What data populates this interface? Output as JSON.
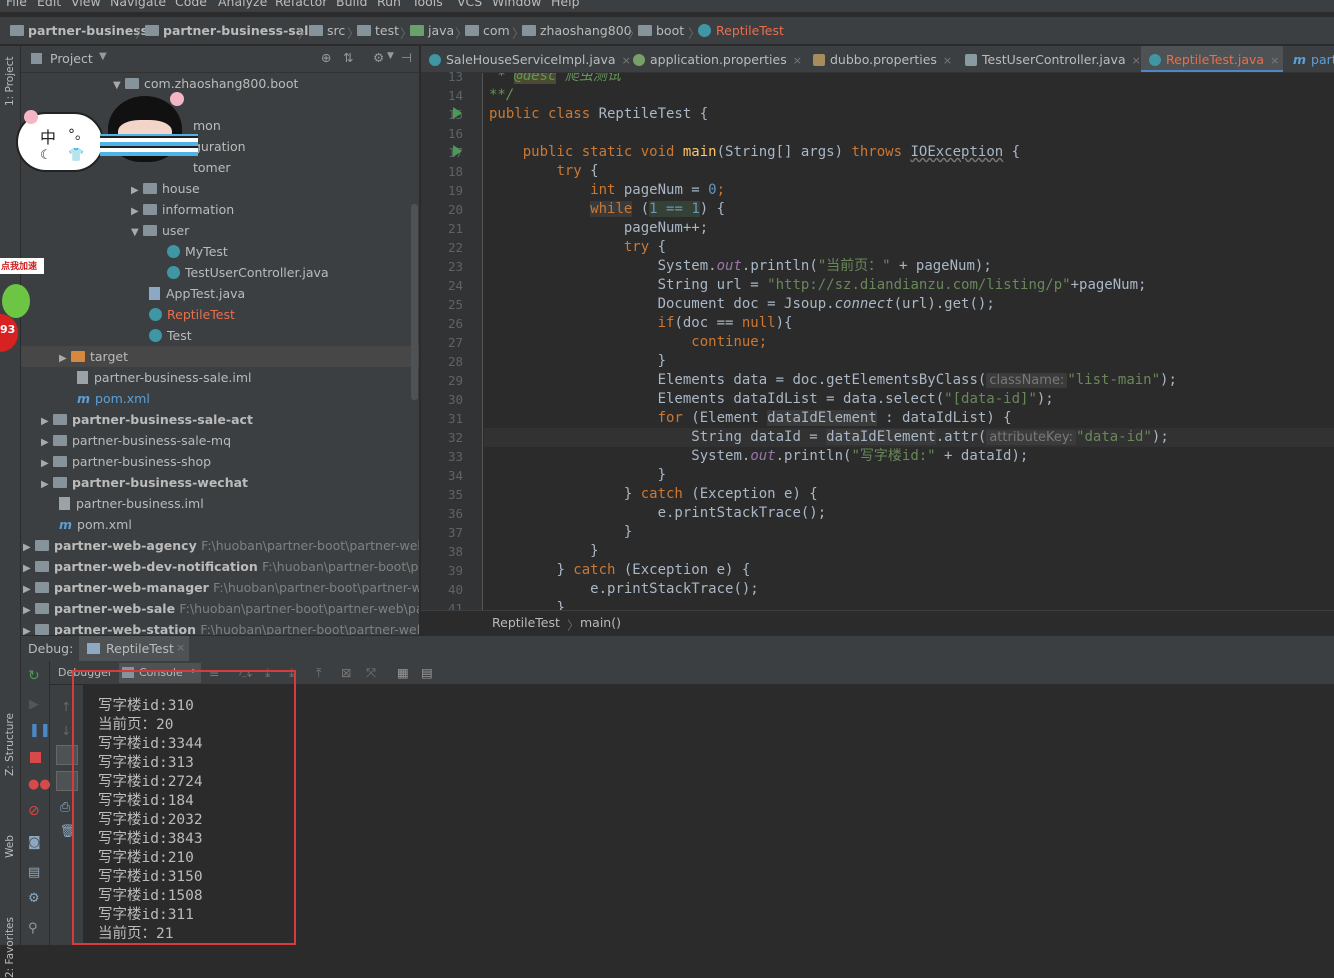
{
  "menu": [
    "File",
    "Edit",
    "View",
    "Navigate",
    "Code",
    "Analyze",
    "Refactor",
    "Build",
    "Run",
    "Tools",
    "VCS",
    "Window",
    "Help"
  ],
  "breadcrumbs": [
    "partner-business",
    "partner-business-sale",
    "src",
    "test",
    "java",
    "com",
    "zhaoshang800",
    "boot",
    "ReptileTest"
  ],
  "left_strip": {
    "project": "1: Project",
    "structure": "Z: Structure",
    "web": "Web",
    "favorites": "2: Favorites"
  },
  "project_panel": {
    "title": "Project"
  },
  "tree": [
    {
      "label": "com.zhaoshang800.boot",
      "kind": "pkg",
      "arrow": "▼"
    },
    {
      "label": "mon",
      "kind": "pkg",
      "arrow": ""
    },
    {
      "label": "guration",
      "kind": "pkg",
      "arrow": ""
    },
    {
      "label": "tomer",
      "kind": "pkg",
      "arrow": ""
    },
    {
      "label": "house",
      "kind": "pkg",
      "arrow": "▶"
    },
    {
      "label": "information",
      "kind": "pkg",
      "arrow": "▶"
    },
    {
      "label": "user",
      "kind": "pkg",
      "arrow": "▼"
    },
    {
      "label": "MyTest",
      "kind": "class",
      "arrow": ""
    },
    {
      "label": "TestUserController.java",
      "kind": "class",
      "arrow": ""
    },
    {
      "label": "AppTest.java",
      "kind": "file",
      "arrow": ""
    },
    {
      "label": "ReptileTest",
      "kind": "class-red",
      "arrow": ""
    },
    {
      "label": "Test",
      "kind": "class",
      "arrow": ""
    },
    {
      "label": "target",
      "kind": "orange",
      "arrow": "▶"
    },
    {
      "label": "partner-business-sale.iml",
      "kind": "file",
      "arrow": ""
    },
    {
      "label": "pom.xml",
      "kind": "mvn-blue",
      "arrow": ""
    },
    {
      "label": "partner-business-sale-act",
      "kind": "mod-bold",
      "arrow": "▶"
    },
    {
      "label": "partner-business-sale-mq",
      "kind": "mod",
      "arrow": "▶"
    },
    {
      "label": "partner-business-shop",
      "kind": "mod",
      "arrow": "▶"
    },
    {
      "label": "partner-business-wechat",
      "kind": "mod-bold",
      "arrow": "▶"
    },
    {
      "label": "partner-business.iml",
      "kind": "file",
      "arrow": ""
    },
    {
      "label": "pom.xml",
      "kind": "mvn",
      "arrow": ""
    },
    {
      "label": "partner-web-agency",
      "kind": "mod-bold",
      "arrow": "▶",
      "path": "F:\\huoban\\partner-boot\\partner-web\\pa"
    },
    {
      "label": "partner-web-dev-notification",
      "kind": "mod-bold",
      "arrow": "▶",
      "path": "F:\\huoban\\partner-boot\\partn"
    },
    {
      "label": "partner-web-manager",
      "kind": "mod-bold",
      "arrow": "▶",
      "path": "F:\\huoban\\partner-boot\\partner-web\\"
    },
    {
      "label": "partner-web-sale",
      "kind": "mod-bold",
      "arrow": "▶",
      "path": "F:\\huoban\\partner-boot\\partner-web\\partr"
    },
    {
      "label": "partner-web-station",
      "kind": "mod-bold",
      "arrow": "▶",
      "path": "F:\\huoban\\partner-boot\\partner-web\\pa"
    }
  ],
  "widgets": {
    "ime_char": "中",
    "ime_punct": "°。",
    "badge_text": "点我加速",
    "badge_num": "93"
  },
  "tabs": [
    {
      "label": "SaleHouseServiceImpl.java"
    },
    {
      "label": "application.properties"
    },
    {
      "label": "dubbo.properties"
    },
    {
      "label": "TestUserController.java"
    },
    {
      "label": "ReptileTest.java"
    },
    {
      "label": "part"
    }
  ],
  "line_numbers": [
    "13",
    "14",
    "15",
    "16",
    "17",
    "18",
    "19",
    "20",
    "21",
    "22",
    "23",
    "24",
    "25",
    "26",
    "27",
    "28",
    "29",
    "30",
    "31",
    "32",
    "33",
    "34",
    "35",
    "36",
    "37",
    "38",
    "39",
    "40",
    "41"
  ],
  "code": {
    "l13_tag": "@desc",
    "l13_text": " 爬虫测试",
    "l14": "**/",
    "l15_k": "public class ",
    "l15_name": "ReptileTest {",
    "l17_k1": "public static void ",
    "l17_fn": "main",
    "l17_args": "(String[] args) ",
    "l17_k2": "throws ",
    "l17_exc": "IOException",
    " l17_end": " {",
    "try": "try",
    "int": "int",
    "pageNum": " pageNum = ",
    "zero": "0",
    "while": "while",
    "one_eq_one": "1 == 1",
    "pp": "pageNum++;",
    "sys": "System.",
    "out": "out",
    "println": ".println(",
    "str_curpage": "\"当前页：\"",
    "plus_pagenum": " + pageNum);",
    "url_decl": "String url = ",
    "url_str": "\"http://sz.diandianzu.com/listing/p\"",
    "url_tail": "+pageNum;",
    "doc_decl": "Document doc = Jsoup.",
    "connect": "connect",
    "doc_tail": "(url).get();",
    "if_null": "(doc == ",
    "null": "null",
    "if_tail": "){",
    "continue": "continue",
    "el_data": "Elements data = doc.getElementsByClass(",
    "hint_class": "className:",
    "str_listmain": "\"list-main\"",
    "el_idlist": "Elements dataIdList = data.select(",
    "str_dataid_sel": "\"[data-id]\"",
    "for": "for",
    "for_mid": " (Element ",
    "dataIdElement": "dataIdElement",
    " for_tail": " : dataIdList) {",
    "str_decl": "String dataId = ",
    "attr": ".attr(",
    "hint_attr": "attributeKey:",
    "str_dataid": "\"data-id\"",
    "str_xiezilou": "\"写字楼id:\"",
    "plus_dataid": " + dataId);",
    "catch": "catch",
    "catch_tail": " (Exception e) {",
    "pst": "e.printStackTrace();"
  },
  "editor_breadcrumb": [
    "ReptileTest",
    "main()"
  ],
  "debug": {
    "label": "Debug:",
    "config": "ReptileTest",
    "tab_debugger": "Debugger",
    "tab_console": "Console"
  },
  "console_output": [
    "写字楼id:310",
    "当前页：20",
    "写字楼id:3344",
    "写字楼id:313",
    "写字楼id:2724",
    "写字楼id:184",
    "写字楼id:2032",
    "写字楼id:3843",
    "写字楼id:210",
    "写字楼id:3150",
    "写字楼id:1508",
    "写字楼id:311",
    "当前页：21"
  ],
  "colors": {
    "accent_red": "#e96e4d",
    "keyword": "#cc7832",
    "string": "#6a8759",
    "number": "#6897bb",
    "annotation_box": "#d83b3b"
  }
}
